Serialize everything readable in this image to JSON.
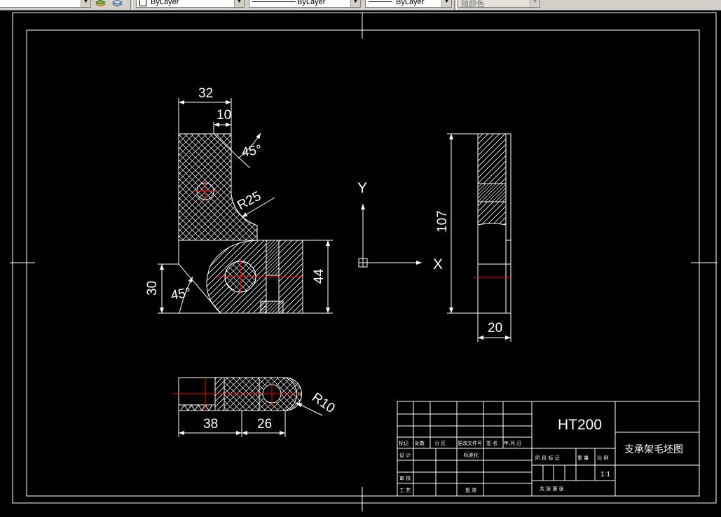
{
  "toolbar": {
    "layer_linetype_control": "ByLayer",
    "linetype_control": "ByLayer",
    "lineweight_control": "ByLayer",
    "plotstyle_control": "随颜色"
  },
  "drawing": {
    "dims": {
      "top_width": "32",
      "notch": "10",
      "chamfer_top": "45°",
      "radius_large": "R25",
      "height_left": "30",
      "chamfer_bottom": "45°",
      "height_right": "44",
      "side_height": "107",
      "side_width": "20",
      "bottom_left": "38",
      "bottom_right": "26",
      "radius_small": "R10"
    },
    "ucs": {
      "y_label": "Y",
      "x_label": "X"
    }
  },
  "title_block": {
    "material": "HT200",
    "drawing_name": "支承架毛坯图",
    "scale": "1:1",
    "row_labels": [
      "标记",
      "处数",
      "分 区",
      "更改文件号",
      "签 名",
      "年.月.日"
    ],
    "design_label": "设 计",
    "standard_label": "标准化",
    "stage_label": "阶 段 标 记",
    "weight_label": "重 量",
    "ratio_label": "比 例",
    "review_label": "审 核",
    "process_label": "工 艺",
    "approve_label": "批 准",
    "sheets_label": "共   张   第   张"
  },
  "colors": {
    "background": "#000000",
    "lines": "#ffffff",
    "center_lines": "#ff0000",
    "toolbar": "#d4d0c8"
  }
}
